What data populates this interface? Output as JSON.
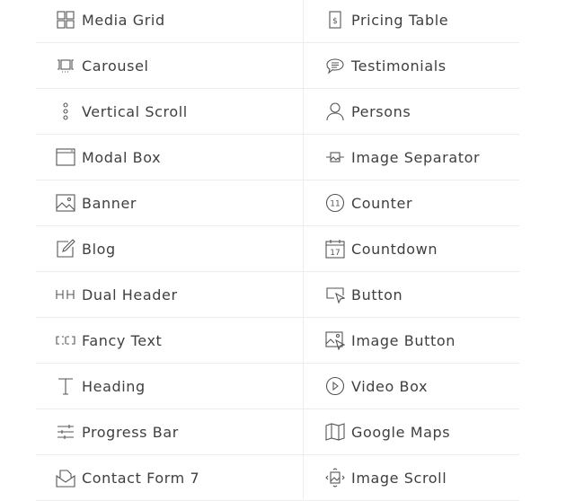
{
  "widgets": [
    {
      "label": "Media Grid",
      "icon": "grid-icon"
    },
    {
      "label": "Pricing Table",
      "icon": "dollar-icon"
    },
    {
      "label": "Carousel",
      "icon": "carousel-icon"
    },
    {
      "label": "Testimonials",
      "icon": "speech-bubble-icon"
    },
    {
      "label": "Vertical Scroll",
      "icon": "dots-vertical-icon"
    },
    {
      "label": "Persons",
      "icon": "person-icon"
    },
    {
      "label": "Modal Box",
      "icon": "window-icon"
    },
    {
      "label": "Image Separator",
      "icon": "image-separator-icon"
    },
    {
      "label": "Banner",
      "icon": "image-icon"
    },
    {
      "label": "Counter",
      "icon": "counter-icon"
    },
    {
      "label": "Blog",
      "icon": "edit-icon"
    },
    {
      "label": "Countdown",
      "icon": "calendar-icon"
    },
    {
      "label": "Dual Header",
      "icon": "dual-header-icon"
    },
    {
      "label": "Button",
      "icon": "button-cursor-icon"
    },
    {
      "label": "Fancy Text",
      "icon": "fancy-text-icon"
    },
    {
      "label": "Image Button",
      "icon": "image-button-icon"
    },
    {
      "label": "Heading",
      "icon": "text-t-icon"
    },
    {
      "label": "Video Box",
      "icon": "play-circle-icon"
    },
    {
      "label": "Progress Bar",
      "icon": "sliders-icon"
    },
    {
      "label": "Google Maps",
      "icon": "map-icon"
    },
    {
      "label": "Contact Form 7",
      "icon": "envelope-icon"
    },
    {
      "label": "Image Scroll",
      "icon": "image-scroll-icon"
    }
  ],
  "counter_icon_text": "11",
  "calendar_icon_text": "17"
}
